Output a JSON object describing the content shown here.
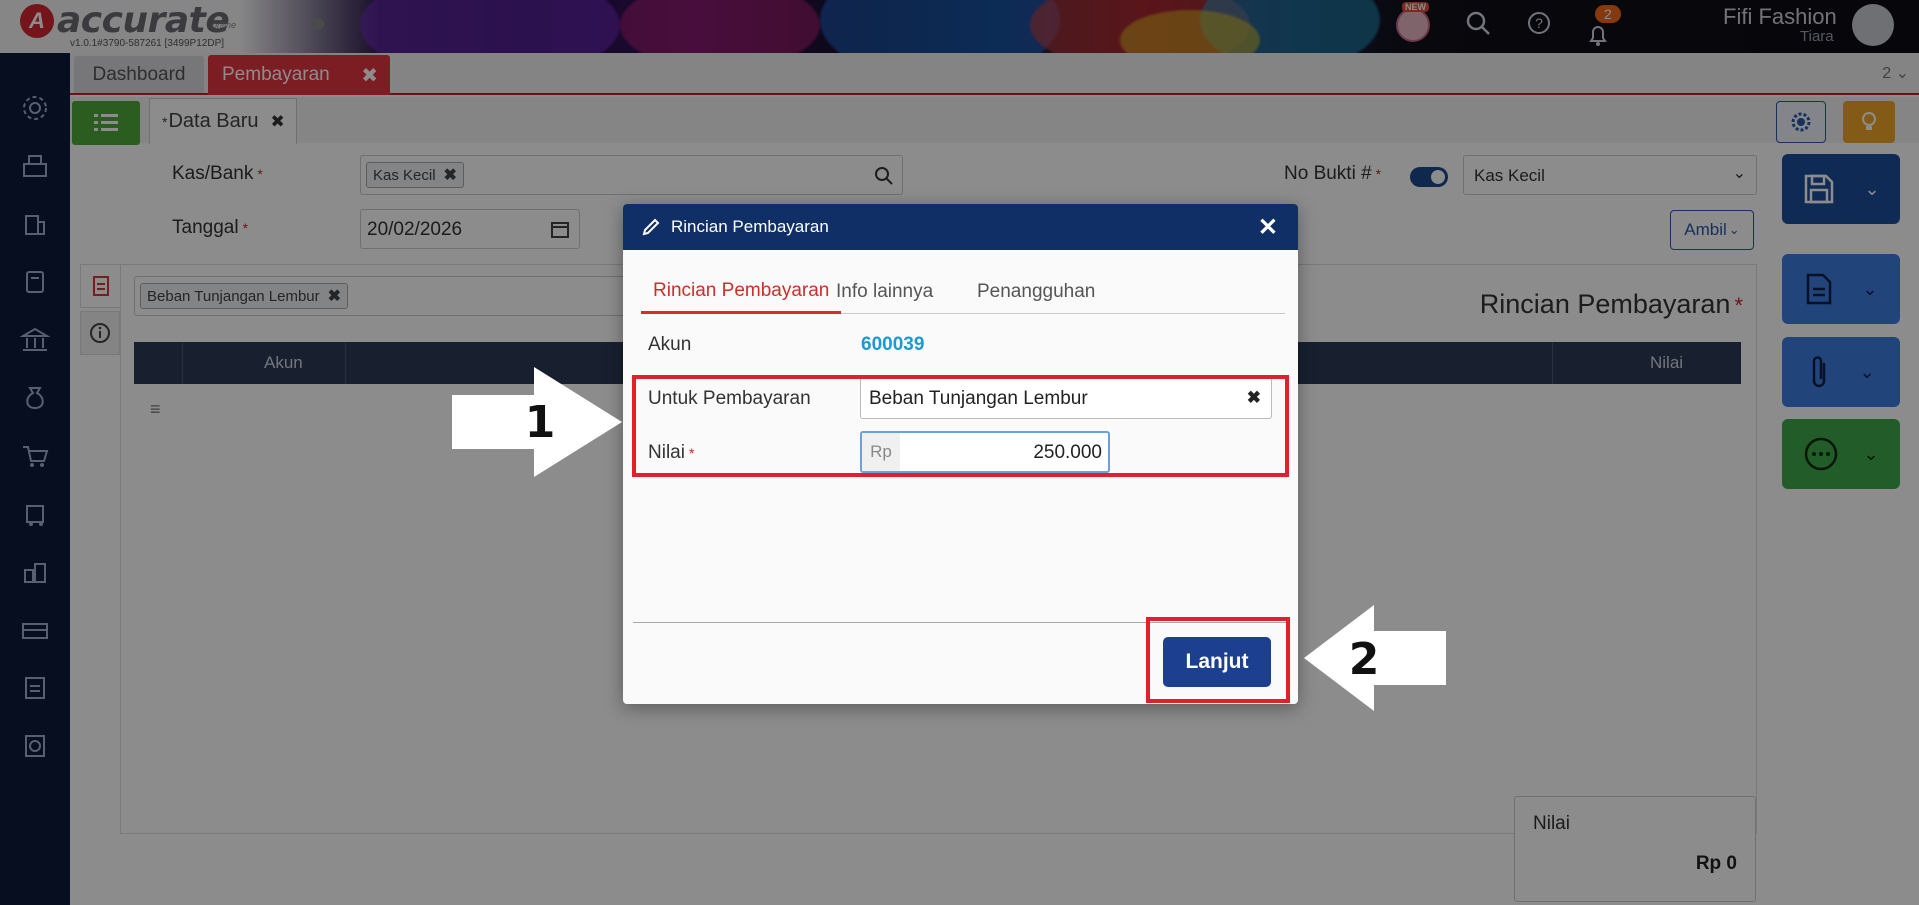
{
  "app": {
    "logo_text": "accurate",
    "logo_sub": "online",
    "version": "v1.0.1#3790-587261 [3499P12DP]",
    "new_badge": "NEW",
    "notif_count": "2",
    "user_name": "Fifi Fashion",
    "user_sub": "Tiara"
  },
  "tabs": {
    "dashboard": "Dashboard",
    "pembayaran": "Pembayaran",
    "count": "2"
  },
  "subtab": {
    "label": "Data Baru",
    "marker": "*"
  },
  "form": {
    "kasbank_label": "Kas/Bank",
    "kasbank_chip": "Kas Kecil",
    "tanggal_label": "Tanggal",
    "tanggal_value": "20/02/2026",
    "nobukti_label": "No Bukti #",
    "nobukti_select": "Kas Kecil",
    "ambil": "Ambil",
    "req": "*"
  },
  "panel": {
    "chip": "Beban Tunjangan Lembur",
    "title": "Rincian Pembayaran",
    "col_akun": "Akun",
    "col_nilai": "Nilai"
  },
  "summary": {
    "label": "Nilai",
    "value": "Rp 0"
  },
  "modal": {
    "title": "Rincian Pembayaran",
    "tabs": [
      "Rincian Pembayaran",
      "Info lainnya",
      "Penangguhan"
    ],
    "akun_label": "Akun",
    "akun_value": "600039",
    "untuk_label": "Untuk Pembayaran",
    "untuk_value": "Beban Tunjangan Lembur",
    "nilai_label": "Nilai",
    "nilai_prefix": "Rp",
    "nilai_value": "250.000",
    "button": "Lanjut"
  },
  "annotations": {
    "step1": "1",
    "step2": "2"
  },
  "colors": {
    "brand_red": "#e0353f",
    "modal_header": "#0f2f66",
    "button_blue": "#1c3f8f",
    "highlight_red": "#e0202a",
    "link_blue": "#1a9ad6"
  }
}
